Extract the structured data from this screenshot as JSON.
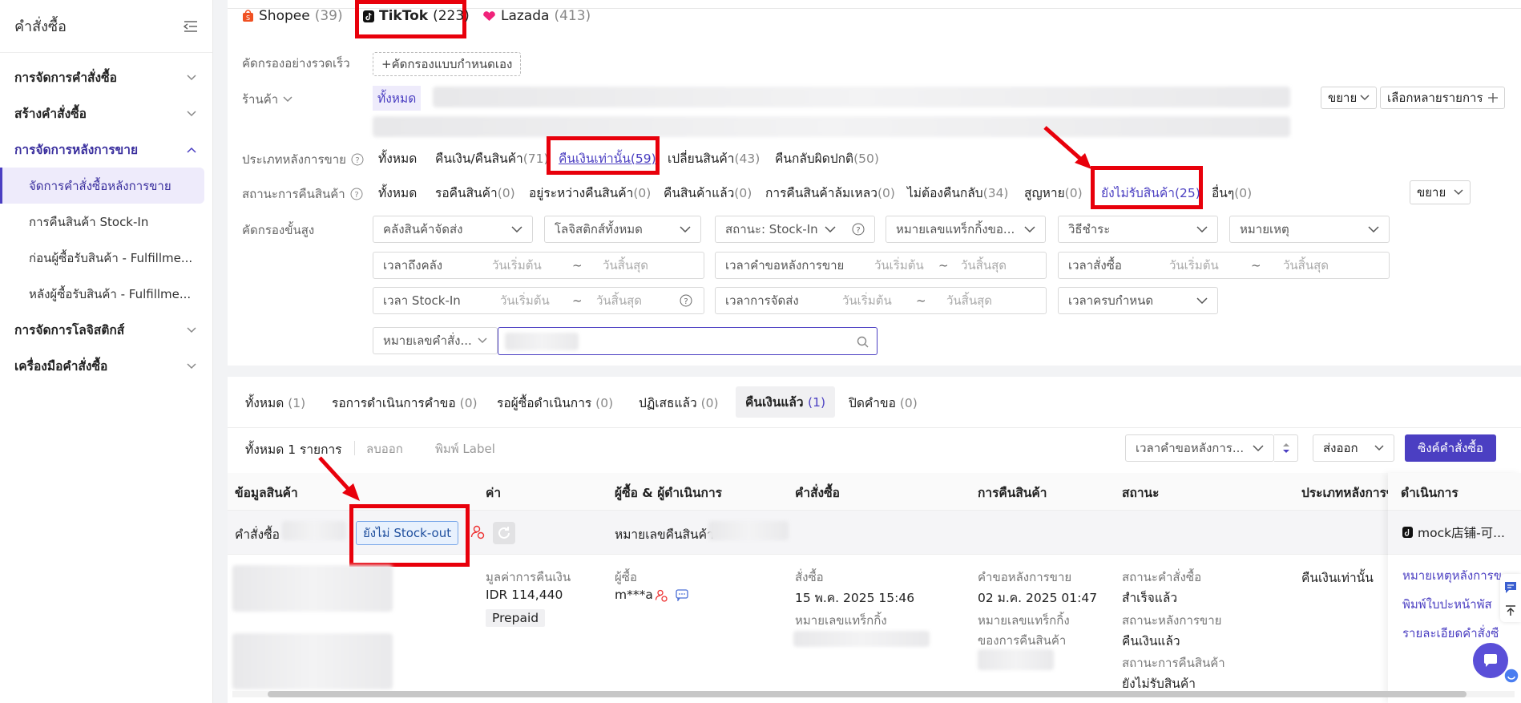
{
  "sidebar": {
    "title": "คำสั่งซื้อ",
    "sections": [
      {
        "label": "การจัดการคำสั่งซื้อ"
      },
      {
        "label": "สร้างคำสั่งซื้อ"
      },
      {
        "label": "การจัดการหลังการขาย"
      },
      {
        "label": "การจัดการโลจิสติกส์"
      },
      {
        "label": "เครื่องมือคำสั่งซื้อ"
      }
    ],
    "items": [
      {
        "label": "จัดการคำสั่งซื้อหลังการขาย"
      },
      {
        "label": "การคืนสินค้า Stock-In"
      },
      {
        "label": "ก่อนผู้ซื้อรับสินค้า - Fulfillme..."
      },
      {
        "label": "หลังผู้ซื้อรับสินค้า - Fulfillme..."
      }
    ]
  },
  "platforms": [
    {
      "name": "Shopee",
      "count": "(39)"
    },
    {
      "name": "TikTok",
      "count": "(223)"
    },
    {
      "name": "Lazada",
      "count": "(413)"
    }
  ],
  "filters": {
    "quick_label": "คัดกรองอย่างรวดเร็ว",
    "custom_button": "+คัดกรองแบบกำหนดเอง",
    "shop_label": "ร้านค้า",
    "shop_all": "ทั้งหมด",
    "expand": "ขยาย",
    "multi_select": "เลือกหลายรายการ",
    "aftersale_type_label": "ประเภทหลังการขาย",
    "aftersale_types": [
      {
        "label": "ทั้งหมด",
        "count": ""
      },
      {
        "label": "คืนเงิน/คืนสินค้า",
        "count": "(71)"
      },
      {
        "label": "คืนเงินเท่านั้น",
        "count": "(59)"
      },
      {
        "label": "เปลี่ยนสินค้า",
        "count": "(43)"
      },
      {
        "label": "คืนกลับผิดปกติ",
        "count": "(50)"
      }
    ],
    "return_status_label": "สถานะการคืนสินค้า",
    "return_statuses": [
      {
        "label": "ทั้งหมด",
        "count": ""
      },
      {
        "label": "รอคืนสินค้า",
        "count": "(0)"
      },
      {
        "label": "อยู่ระหว่างคืนสินค้า",
        "count": "(0)"
      },
      {
        "label": "คืนสินค้าแล้ว",
        "count": "(0)"
      },
      {
        "label": "การคืนสินค้าล้มเหลว",
        "count": "(0)"
      },
      {
        "label": "ไม่ต้องคืนกลับ",
        "count": "(34)"
      },
      {
        "label": "สูญหาย",
        "count": "(0)"
      },
      {
        "label": "ยังไม่รับสินค้า",
        "count": "(25)"
      },
      {
        "label": "อื่นๆ",
        "count": "(0)"
      }
    ],
    "advanced_label": "คัดกรองขั้นสูง",
    "selects": [
      "คลังสินค้าจัดส่ง",
      "โลจิสติกส์ทั้งหมด",
      "สถานะ: Stock-In",
      "หมายเลขแทร็กกิ้งขอ...",
      "วิธีชำระ",
      "หมายเหตุ"
    ],
    "date_ranges": [
      {
        "label": "เวลาถึงคลัง",
        "start": "วันเริ่มต้น",
        "end": "วันสิ้นสุด"
      },
      {
        "label": "เวลาคำขอหลังการขาย",
        "start": "วันเริ่มต้น",
        "end": "วันสิ้นสุด"
      },
      {
        "label": "เวลาสั่งซื้อ",
        "start": "วันเริ่มต้น",
        "end": "วันสิ้นสุด"
      },
      {
        "label": "เวลา Stock-In",
        "start": "วันเริ่มต้น",
        "end": "วันสิ้นสุด"
      },
      {
        "label": "เวลาการจัดส่ง",
        "start": "วันเริ่มต้น",
        "end": "วันสิ้นสุด"
      }
    ],
    "deadline_select": "เวลาครบกำหนด",
    "search_type": "หมายเลขคำสั่ง...",
    "range_sep": "~"
  },
  "tabs": [
    {
      "label": "ทั้งหมด",
      "count": "(1)"
    },
    {
      "label": "รอการดำเนินการคำขอ",
      "count": "(0)"
    },
    {
      "label": "รอผู้ซื้อดำเนินการ",
      "count": "(0)"
    },
    {
      "label": "ปฏิเสธแล้ว",
      "count": "(0)"
    },
    {
      "label": "คืนเงินแล้ว",
      "count": "(1)"
    },
    {
      "label": "ปิดคำขอ",
      "count": "(0)"
    }
  ],
  "toolbar": {
    "total": "ทั้งหมด 1 รายการ",
    "remove": "ลบออก",
    "print": "พิมพ์ Label",
    "sort": "เวลาคำขอหลังการ...",
    "export": "ส่งออก",
    "sync": "ซิงค์คำสั่งซื้อ"
  },
  "table": {
    "headers": [
      "ข้อมูลสินค้า",
      "ค่า",
      "ผู้ซื้อ & ผู้ดำเนินการ",
      "คำสั่งซื้อ",
      "การคืนสินค้า",
      "สถานะ",
      "ประเภทหลังการขาย",
      "ดำเนินการ"
    ],
    "order_prefix": "คำสั่งซื้อ",
    "stock_badge": "ยังไม่ Stock-out",
    "return_no_label": "หมายเลขคืนสินค้า",
    "store": "mock店铺-可...",
    "refund_label": "มูลค่าการคืนเงิน",
    "refund_value": "IDR 114,440",
    "payment": "Prepaid",
    "buyer_label": "ผู้ซื้อ",
    "buyer": "m***a",
    "order_label": "สั่งซื้อ",
    "order_time": "15 พ.ค. 2025 15:46",
    "tracking_label": "หมายเลขแทร็กกิ้ง",
    "request_label": "คำขอหลังการขาย",
    "request_time": "02 ม.ค. 2025 01:47",
    "return_tracking_label_1": "หมายเลขแทร็กกิ้ง",
    "return_tracking_label_2": "ของการคืนสินค้า",
    "order_status_label": "สถานะคำสั่งซื้อ",
    "order_status": "สำเร็จแล้ว",
    "aftersale_status_label": "สถานะหลังการขาย",
    "aftersale_status": "คืนเงินแล้ว",
    "return_status_label": "สถานะการคืนสินค้า",
    "return_status": "ยังไม่รับสินค้า",
    "type": "คืนเงินเท่านั้น",
    "actions": [
      "หมายเหตุหลังการข",
      "พิมพ์ใบปะหน้าพัส",
      "รายละเอียดคำสั่งซื"
    ]
  },
  "colors": {
    "accent": "#4b3fc2",
    "highlight": "#e8000b"
  }
}
